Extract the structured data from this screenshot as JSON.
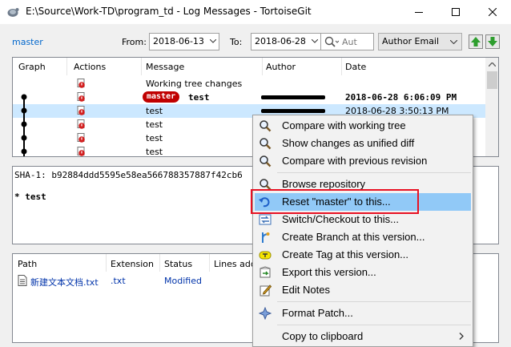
{
  "window": {
    "title": "E:\\Source\\Work-TD\\program_td - Log Messages - TortoiseGit"
  },
  "toolbar": {
    "branch_link": "master",
    "from_label": "From:",
    "from_date": "2018-06-13",
    "to_label": "To:",
    "to_date": "2018-06-28",
    "search_placeholder": "Aut",
    "filter_value": "Author Email"
  },
  "log": {
    "columns": [
      "Graph",
      "Actions",
      "Message",
      "Author",
      "Date"
    ],
    "rows": [
      {
        "message": "Working tree changes",
        "date": "",
        "ref": ""
      },
      {
        "message": "test",
        "date": "2018-06-28 6:06:09 PM",
        "ref": "master"
      },
      {
        "message": "test",
        "date": "2018-06-28 3:50:13 PM",
        "ref": ""
      },
      {
        "message": "test",
        "date": "",
        "ref": ""
      },
      {
        "message": "test",
        "date": "",
        "ref": ""
      },
      {
        "message": "test",
        "date": "",
        "ref": ""
      }
    ]
  },
  "detail": {
    "sha_line": "SHA-1: b92884ddd5595e58ea566788357887f42cb6",
    "message_line": "* test"
  },
  "files": {
    "columns": [
      "Path",
      "Extension",
      "Status",
      "Lines added"
    ],
    "rows": [
      {
        "path": "新建文本文档.txt",
        "extension": ".txt",
        "status": "Modified"
      }
    ]
  },
  "context_menu": {
    "items": [
      {
        "label": "Compare with working tree",
        "icon": "magnifier-compare-icon"
      },
      {
        "label": "Show changes as unified diff",
        "icon": "magnifier-diff-icon"
      },
      {
        "label": "Compare with previous revision",
        "icon": "magnifier-previous-icon"
      },
      {
        "label": "Browse repository",
        "icon": "magnifier-browse-icon"
      },
      {
        "label": "Reset \"master\" to this...",
        "icon": "reset-arrow-icon"
      },
      {
        "label": "Switch/Checkout to this...",
        "icon": "switch-checkout-icon"
      },
      {
        "label": "Create Branch at this version...",
        "icon": "create-branch-icon"
      },
      {
        "label": "Create Tag at this version...",
        "icon": "create-tag-icon"
      },
      {
        "label": "Export this version...",
        "icon": "export-icon"
      },
      {
        "label": "Edit Notes",
        "icon": "edit-notes-icon"
      },
      {
        "label": "Format Patch...",
        "icon": "format-patch-icon"
      },
      {
        "label": "Copy to clipboard",
        "icon": ""
      }
    ]
  },
  "colors": {
    "menu_highlight": "#91c9f7",
    "highlight_border": "#e81123",
    "selection": "#cce8ff",
    "branch_label": "#c00000",
    "link": "#0066cc"
  }
}
